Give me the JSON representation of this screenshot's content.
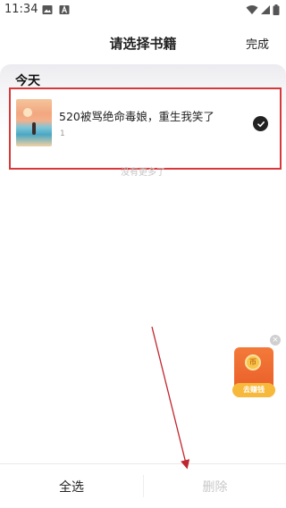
{
  "status_bar": {
    "time": "11:34",
    "icons": [
      "gallery-icon",
      "a-badge-icon",
      "wifi-icon",
      "signal-icon",
      "battery-icon"
    ]
  },
  "header": {
    "title": "请选择书籍",
    "done_label": "完成"
  },
  "section": {
    "title": "今天"
  },
  "books": [
    {
      "title": "520被骂绝命毒娘，重生我笑了",
      "progress_text": "1",
      "selected": true
    }
  ],
  "list_footer": "没有更多了",
  "floating_reward": {
    "label": "去赚钱",
    "coin_glyph": "币"
  },
  "bottom_bar": {
    "select_all_label": "全选",
    "delete_label": "删除"
  },
  "colors": {
    "highlight_border": "#d9383a",
    "annotation_arrow": "#c0262d",
    "reward_orange": "#e85a27"
  }
}
